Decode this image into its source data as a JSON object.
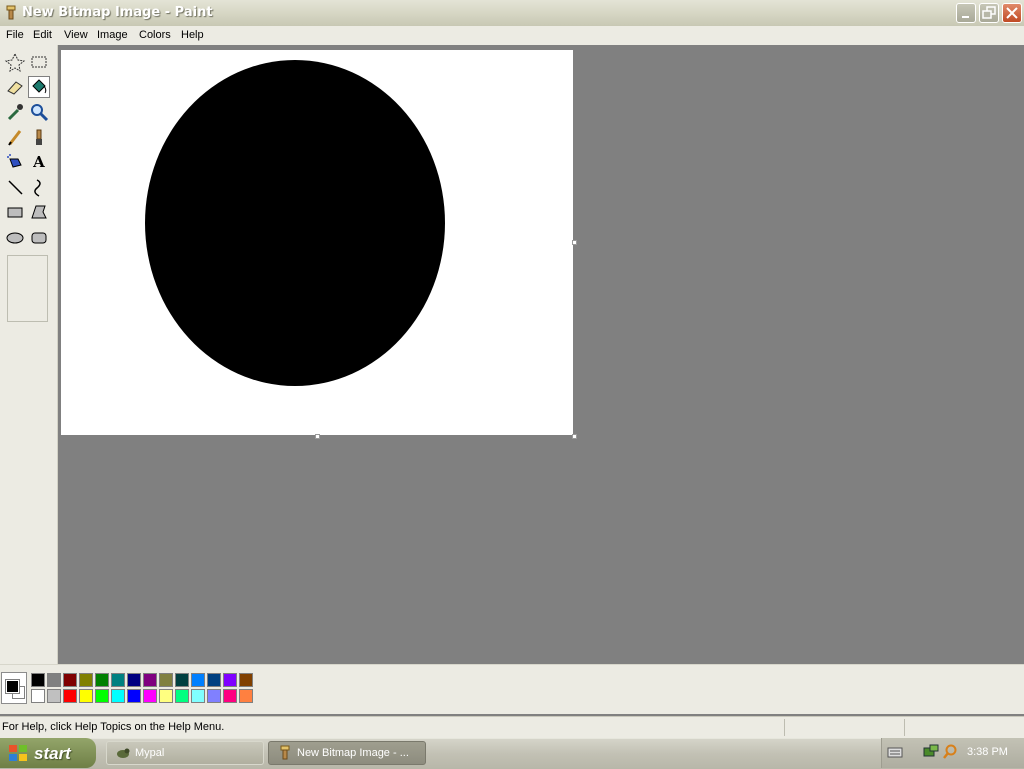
{
  "window": {
    "title": "New Bitmap Image - Paint"
  },
  "menu": [
    "File",
    "Edit",
    "View",
    "Image",
    "Colors",
    "Help"
  ],
  "tools": [
    {
      "name": "free-form-select-tool",
      "icon": "star-select-icon"
    },
    {
      "name": "select-tool",
      "icon": "rect-select-icon"
    },
    {
      "name": "eraser-tool",
      "icon": "eraser-icon"
    },
    {
      "name": "fill-tool",
      "icon": "paint-bucket-icon",
      "selected": true
    },
    {
      "name": "pick-color-tool",
      "icon": "eyedropper-icon"
    },
    {
      "name": "magnifier-tool",
      "icon": "magnifier-icon"
    },
    {
      "name": "pencil-tool",
      "icon": "pencil-icon"
    },
    {
      "name": "brush-tool",
      "icon": "brush-icon"
    },
    {
      "name": "airbrush-tool",
      "icon": "airbrush-icon"
    },
    {
      "name": "text-tool",
      "icon": "text-icon",
      "glyph": "A"
    },
    {
      "name": "line-tool",
      "icon": "line-icon"
    },
    {
      "name": "curve-tool",
      "icon": "curve-icon"
    },
    {
      "name": "rectangle-tool",
      "icon": "rectangle-icon"
    },
    {
      "name": "polygon-tool",
      "icon": "polygon-icon"
    },
    {
      "name": "ellipse-tool",
      "icon": "ellipse-icon"
    },
    {
      "name": "rounded-rectangle-tool",
      "icon": "rounded-rect-icon"
    }
  ],
  "palette": {
    "foreground": "#000000",
    "background": "#ffffff",
    "row1": [
      "#000000",
      "#808080",
      "#800000",
      "#808000",
      "#008000",
      "#008080",
      "#000080",
      "#800080",
      "#808040",
      "#004040",
      "#0080ff",
      "#004080",
      "#8000ff",
      "#804000"
    ],
    "row2": [
      "#ffffff",
      "#c0c0c0",
      "#ff0000",
      "#ffff00",
      "#00ff00",
      "#00ffff",
      "#0000ff",
      "#ff00ff",
      "#ffff80",
      "#00ff80",
      "#80ffff",
      "#8080ff",
      "#ff0080",
      "#ff8040"
    ]
  },
  "status": {
    "text": "For Help, click Help Topics on the Help Menu."
  },
  "taskbar": {
    "start": "start",
    "tasks": [
      {
        "label": "Mypal",
        "active": false
      },
      {
        "label": "New Bitmap Image - ...",
        "active": true
      }
    ],
    "clock": "3:38 PM"
  }
}
